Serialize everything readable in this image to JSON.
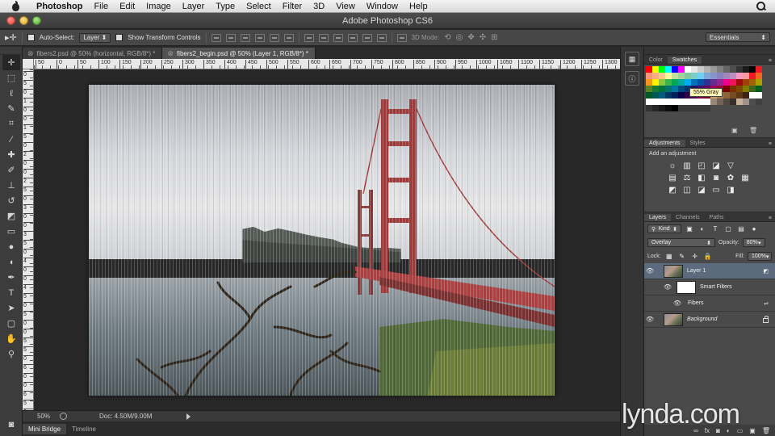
{
  "menubar": {
    "app_name": "Photoshop",
    "menus": [
      "File",
      "Edit",
      "Image",
      "Layer",
      "Type",
      "Select",
      "Filter",
      "3D",
      "View",
      "Window",
      "Help"
    ]
  },
  "window": {
    "title": "Adobe Photoshop CS6"
  },
  "options_bar": {
    "auto_select_label": "Auto-Select:",
    "auto_select_value": "Layer",
    "show_transform_label": "Show Transform Controls",
    "mode_3d_label": "3D Mode:",
    "workspace": "Essentials"
  },
  "document_tabs": [
    {
      "label": "fibers2.psd @ 50% (horizontal, RGB/8*) *",
      "active": false
    },
    {
      "label": "fibers2_begin.psd @ 50% (Layer 1, RGB/8*) *",
      "active": true
    }
  ],
  "ruler": {
    "h_labels": [
      "50",
      "0",
      "50",
      "100",
      "150",
      "200",
      "250",
      "300",
      "350",
      "400",
      "450",
      "500",
      "550",
      "600",
      "650",
      "700",
      "750",
      "800",
      "850",
      "900",
      "950",
      "1000",
      "1050",
      "1100",
      "1150",
      "1200",
      "1250",
      "1300"
    ],
    "v_labels": [
      "0",
      "5",
      "0",
      "1",
      "0",
      "0",
      "1",
      "5",
      "0",
      "2",
      "0",
      "0",
      "2",
      "5",
      "0",
      "3",
      "0",
      "0",
      "3",
      "5",
      "0",
      "4",
      "0",
      "0",
      "4",
      "5",
      "0",
      "5",
      "0",
      "0",
      "5",
      "5",
      "0",
      "6",
      "0",
      "0",
      "6",
      "5",
      "0"
    ]
  },
  "status": {
    "zoom": "50%",
    "doc": "Doc: 4.50M/9.00M"
  },
  "bottom_tabs": [
    "Mini Bridge",
    "Timeline"
  ],
  "panels": {
    "swatch_tabs": [
      "Color",
      "Swatches"
    ],
    "tooltip": "55% Gray",
    "adjust_tabs": [
      "Adjustments",
      "Styles"
    ],
    "add_adjustment": "Add an adjustment",
    "layer_tabs": [
      "Layers",
      "Channels",
      "Paths"
    ],
    "kind_label": "Kind",
    "blend_mode": "Overlay",
    "opacity_label": "Opacity:",
    "opacity_value": "80%",
    "lock_label": "Lock:",
    "fill_label": "Fill:",
    "fill_value": "100%",
    "layers": [
      {
        "name": "Layer 1",
        "selected": true
      },
      {
        "name": "Smart Filters",
        "selected": false
      },
      {
        "name": "Fibers",
        "selected": false
      },
      {
        "name": "Background",
        "selected": false
      }
    ]
  },
  "watermark": "lynda.com",
  "swatch_colors": [
    "#ff0000",
    "#ffff00",
    "#00ff00",
    "#00ffff",
    "#0000ff",
    "#ff00ff",
    "#ffffff",
    "#e6e6e6",
    "#cccccc",
    "#b3b3b3",
    "#999999",
    "#808080",
    "#666666",
    "#4d4d4d",
    "#333333",
    "#1a1a1a",
    "#000000",
    "#ee1d24",
    "#f7977a",
    "#f9ad81",
    "#fdc68a",
    "#fff79a",
    "#c4df9b",
    "#a3d39c",
    "#82ca9d",
    "#7bcdc8",
    "#6ecff6",
    "#7ea7d8",
    "#8493ca",
    "#8882be",
    "#a187be",
    "#bc8dbf",
    "#f49ac2",
    "#f6989d",
    "#ed1c24",
    "#f26522",
    "#f7941d",
    "#fff200",
    "#8dc63f",
    "#39b54a",
    "#00a651",
    "#00a99d",
    "#00aeef",
    "#0072bc",
    "#0054a6",
    "#2e3192",
    "#662d91",
    "#92278f",
    "#ec008c",
    "#ed145b",
    "#9e0b0f",
    "#a0410d",
    "#a36209",
    "#aba000",
    "#598527",
    "#1a7b30",
    "#007236",
    "#00746b",
    "#0076a3",
    "#004b80",
    "#003471",
    "#1b1464",
    "#440e62",
    "#630460",
    "#9e005d",
    "#9e0039",
    "#790000",
    "#7b2e00",
    "#7d4900",
    "#827b00",
    "#406618",
    "#005e20",
    "#005826",
    "#005952",
    "#005b7f",
    "#003663",
    "#002157",
    "#0d004c",
    "#32004b",
    "#4b0049",
    "#7b0046",
    "#7a0026",
    "#c69c6d",
    "#a67c52",
    "#8c6239",
    "#754c24",
    "#603913",
    "#3c2415",
    "#ffffff",
    "#ffffff",
    "#ffffff",
    "#ffffff",
    "#ffffff",
    "#ffffff",
    "#ffffff",
    "#ffffff",
    "#ffffff",
    "#ffffff",
    "#ffffff",
    "#ffffff",
    "#998675",
    "#736357",
    "#534741",
    "#362f2d",
    "#c7b299",
    "#a19189",
    "#4d4d4d",
    "#404040",
    "#333333",
    "#262626",
    "#1a1a1a",
    "#0d0d0d",
    "#000000",
    "#3a3a3a",
    "#3a3a3a",
    "#3a3a3a",
    "#3a3a3a",
    "#3a3a3a"
  ],
  "tool_icons": [
    "move-icon",
    "marquee-icon",
    "lasso-icon",
    "quick-select-icon",
    "crop-icon",
    "eyedropper-icon",
    "spot-heal-icon",
    "brush-icon",
    "clone-stamp-icon",
    "history-brush-icon",
    "eraser-icon",
    "gradient-icon",
    "blur-icon",
    "dodge-icon",
    "pen-icon",
    "type-icon",
    "path-select-icon",
    "shape-icon",
    "hand-icon",
    "zoom-icon"
  ]
}
